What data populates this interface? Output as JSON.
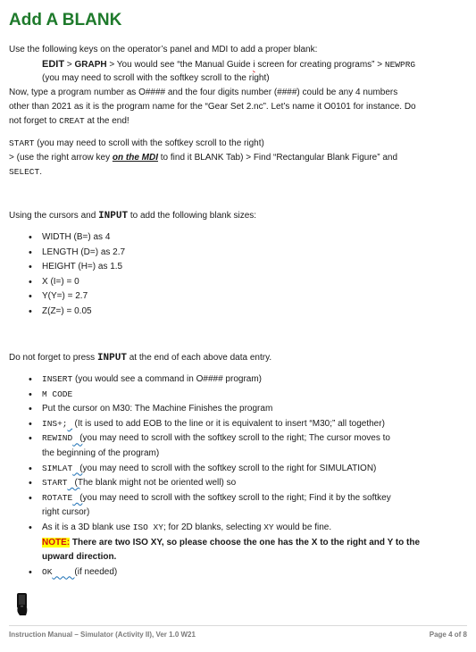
{
  "title": "Add A BLANK",
  "intro": {
    "line1": "Use the following keys on the operator’s panel and MDI to add a proper blank:",
    "edit_key": "EDIT",
    "sep1": " > ",
    "graph_key": "GRAPH",
    "line2_rest": " > You would see “the Manual Guide ",
    "i_mark": "i",
    "line2_rest2": " screen for creating programs” > ",
    "newprg": "NEWPRG",
    "line3": "(you may need to scroll with the softkey scroll to the right)",
    "line4": "Now, type a program number as O#### and the four digits number (####) could be any 4 numbers",
    "line5": "other than 2021 as it is the program name for the “Gear Set 2.nc”. Let’s name it O0101 for instance. Do",
    "line6_a": "not forget to ",
    "creat": "CREAT",
    "line6_b": " at the end!"
  },
  "start_block": {
    "start": "START",
    "line1_rest": " (you may need to scroll with the softkey scroll to the right)",
    "line2_a": "> (use the right arrow key ",
    "on_mdi": "on the MDI",
    "line2_b": " to find it BLANK Tab) > Find “Rectangular Blank Figure” and",
    "select": "SELECT",
    "select_end": "."
  },
  "cursors": {
    "text_a": "Using the cursors and ",
    "input": "INPUT",
    "text_b": " to add the following blank sizes:"
  },
  "sizes": [
    "WIDTH (B=) as 4",
    "LENGTH (D=) as 2.7",
    "HEIGHT (H=) as 1.5",
    "X (I=) = 0",
    "Y(Y=) = 2.7",
    "Z(Z=) = 0.05"
  ],
  "press": {
    "text_a": "Do not forget to press ",
    "input": "INPUT",
    "text_b": " at the end of each above data entry."
  },
  "steps": {
    "insert_code": "INSERT",
    "insert_text": " (you would see a command in O#### program)",
    "mcode": "M CODE",
    "put_cursor": "Put the cursor on M30: The Machine Finishes the program",
    "ins_code": "INS+;",
    "ins_text": "(It is used to add EOB to the line or it is equivalent to insert “M30;” all together)",
    "rewind_code": "REWIND",
    "rewind_text": "(you may need to scroll with the softkey scroll to the right; The cursor moves to",
    "rewind_text2": "the beginning of the program)",
    "simlat_code": "SIMLAT",
    "simlat_text": "(you may need to scroll with the softkey scroll to the right for SIMULATION)",
    "start_code": "START",
    "start_text": "(The blank might not be oriented well) so",
    "rotate_code": "ROTATE",
    "rotate_text": "(you may need to scroll with the softkey scroll to the right; Find it by the softkey",
    "rotate_text2": "right cursor)",
    "iso_a": "As it is a 3D blank use ",
    "iso_code": "ISO XY",
    "iso_b": "; for 2D blanks, selecting ",
    "xy_code": "XY",
    "iso_c": " would be fine.",
    "note_label": "NOTE:",
    "note_text": " There are two ISO XY, so please choose the one has the X to the right and Y to the",
    "note_text2": "upward direction.",
    "ok_code": "OK",
    "ok_text": "(if needed)"
  },
  "icon": "phone-device-icon",
  "footer": {
    "left": "Instruction Manual – Simulator (Activity II), Ver 1.0 W21",
    "right": "Page 4 of 8"
  },
  "colors": {
    "title": "#1e7a2b",
    "note_highlight": "#ffff00",
    "note_text": "#d01010"
  }
}
